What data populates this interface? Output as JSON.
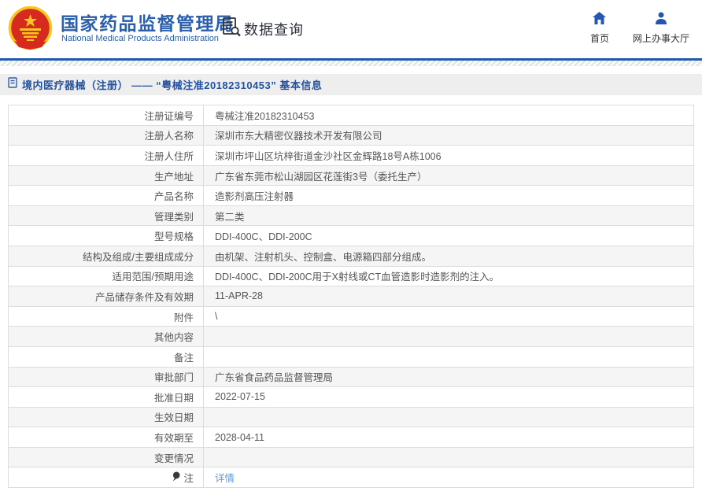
{
  "header": {
    "brand": {
      "title": "国家药品监督管理局",
      "subtitle": "National Medical Products Administration"
    },
    "data_query_label": "数据查询",
    "nav_right": [
      {
        "label": "首页",
        "icon": "home-icon"
      },
      {
        "label": "网上办事大厅",
        "icon": "user-icon"
      }
    ]
  },
  "page": {
    "title": "境内医疗器械（注册） —— “粤械注准20182310453” 基本信息"
  },
  "table": {
    "rows": [
      {
        "label": "注册证编号",
        "value": "粤械注准20182310453"
      },
      {
        "label": "注册人名称",
        "value": "深圳市东大精密仪器技术开发有限公司"
      },
      {
        "label": "注册人住所",
        "value": "深圳市坪山区坑梓街道金沙社区金辉路18号A栋1006"
      },
      {
        "label": "生产地址",
        "value": "广东省东莞市松山湖园区花莲街3号（委托生产）"
      },
      {
        "label": "产品名称",
        "value": "造影剂高压注射器"
      },
      {
        "label": "管理类别",
        "value": "第二类"
      },
      {
        "label": "型号规格",
        "value": "DDI-400C、DDI-200C"
      },
      {
        "label": "结构及组成/主要组成成分",
        "value": "由机架、注射机头、控制盒、电源箱四部分组成。"
      },
      {
        "label": "适用范围/预期用途",
        "value": "DDI-400C、DDI-200C用于X射线或CT血管造影时造影剂的注入。"
      },
      {
        "label": "产品储存条件及有效期",
        "value": "11-APR-28"
      },
      {
        "label": "附件",
        "value": "\\"
      },
      {
        "label": "其他内容",
        "value": ""
      },
      {
        "label": "备注",
        "value": ""
      },
      {
        "label": "审批部门",
        "value": "广东省食品药品监督管理局"
      },
      {
        "label": "批准日期",
        "value": "2022-07-15"
      },
      {
        "label": "生效日期",
        "value": ""
      },
      {
        "label": "有效期至",
        "value": "2028-04-11"
      },
      {
        "label": "变更情况",
        "value": ""
      },
      {
        "label": "注",
        "value": "详情",
        "link": true,
        "label_icon": "note-balloon-icon"
      }
    ]
  },
  "colors": {
    "brand_blue": "#2b5fad",
    "divider_blue": "#1e5bb0",
    "titlebar_bg": "#eeeeee",
    "table_border": "#dcdcdc",
    "zebra_bg": "#f5f5f5",
    "text_gray": "#555555",
    "link_blue": "#5e9ae6",
    "emblem_red": "#d62a1e",
    "emblem_gold": "#f7c71e"
  }
}
